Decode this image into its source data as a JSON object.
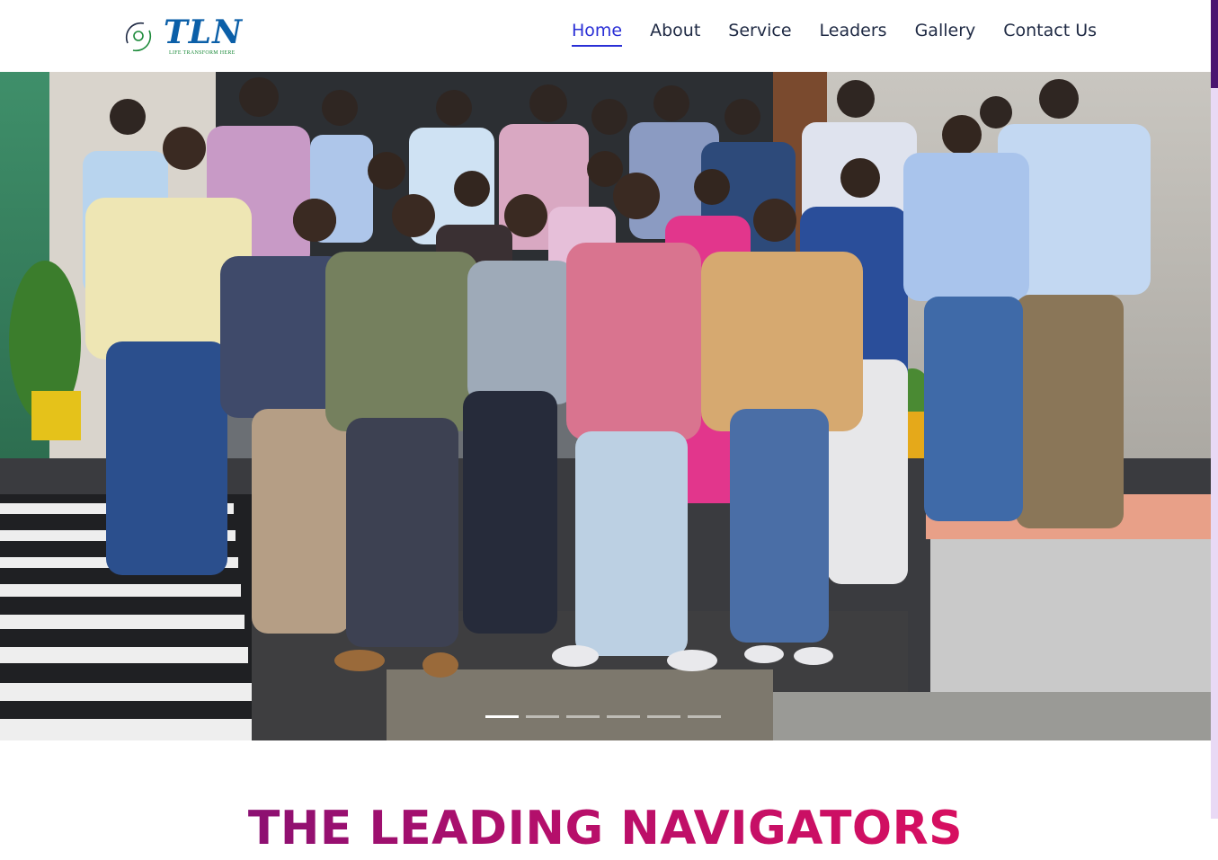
{
  "brand": {
    "logo_text": "TLN",
    "tagline": "LIFE TRANSFORM HERE"
  },
  "nav": {
    "items": [
      {
        "label": "Home",
        "active": true
      },
      {
        "label": "About",
        "active": false
      },
      {
        "label": "Service",
        "active": false
      },
      {
        "label": "Leaders",
        "active": false
      },
      {
        "label": "Gallery",
        "active": false
      },
      {
        "label": "Contact Us",
        "active": false
      }
    ]
  },
  "hero": {
    "image_label": "group-photo",
    "slides_count": 6,
    "active_slide": 1
  },
  "main": {
    "heading": "THE LEADING NAVIGATORS"
  },
  "colors": {
    "nav_active": "#2a2fd6",
    "nav_text": "#1f2a44",
    "heading_gradient_start": "#6a1077",
    "heading_gradient_end": "#ec0f5a",
    "scroll_thumb": "#4a1670",
    "logo_blue": "#0b5fa8"
  }
}
